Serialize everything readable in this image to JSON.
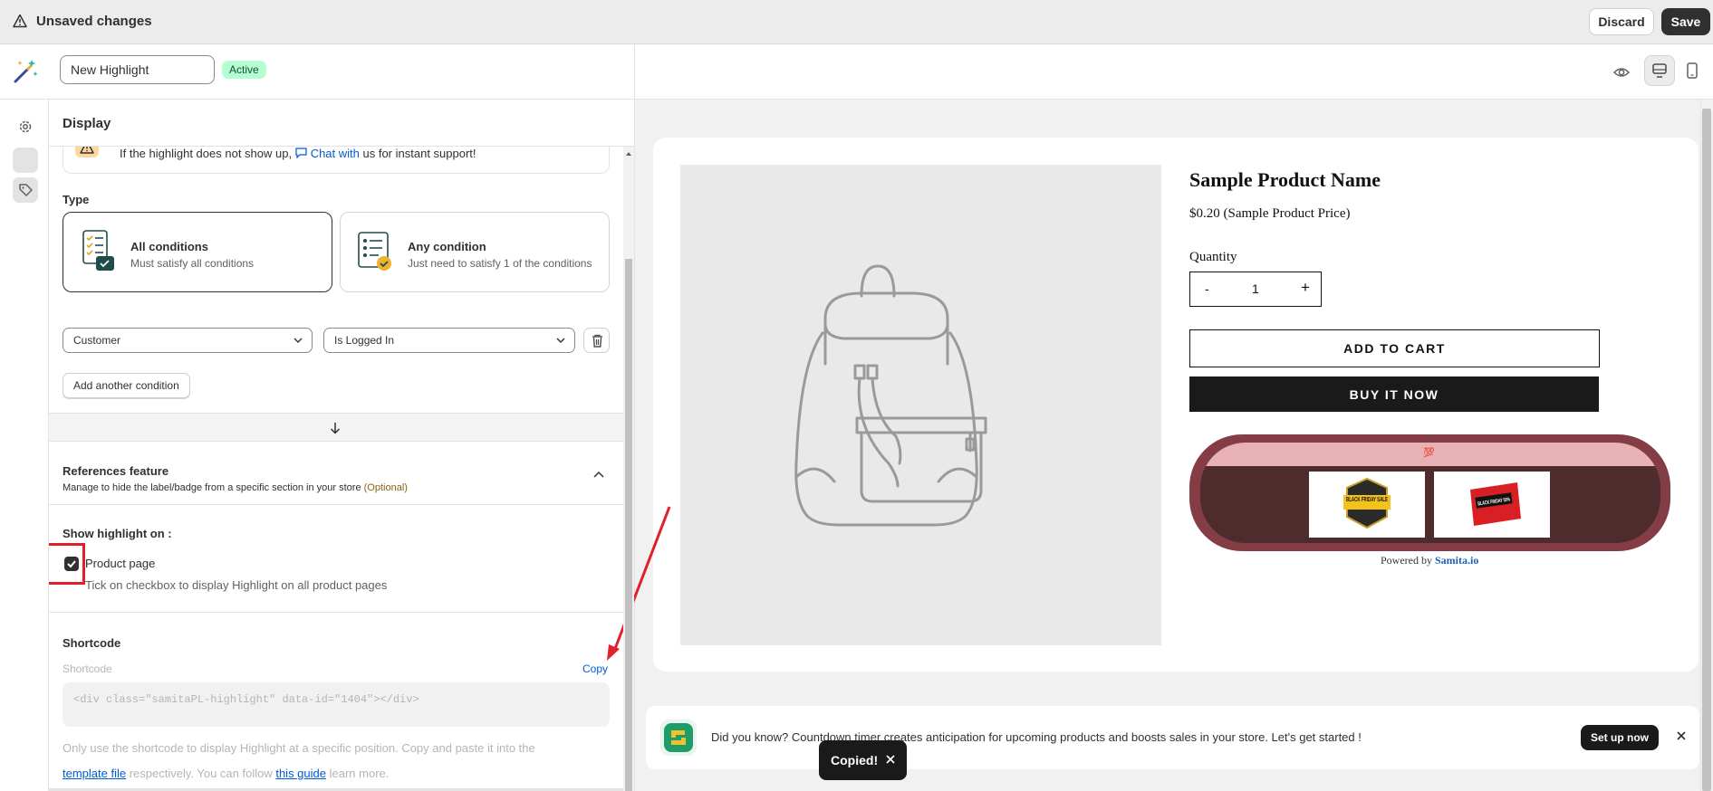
{
  "topbar": {
    "title": "Unsaved changes",
    "discard_label": "Discard",
    "save_label": "Save"
  },
  "subbar": {
    "highlight_name": "New Highlight",
    "status_badge": "Active"
  },
  "panel": {
    "header": "Display",
    "notice": {
      "before": "If the highlight does not show up, ",
      "link": "Chat with",
      "after": " us for instant support!"
    },
    "type_label": "Type",
    "conditions": [
      {
        "title": "All conditions",
        "subtitle": "Must satisfy all conditions",
        "selected": true
      },
      {
        "title": "Any condition",
        "subtitle": "Just need to satisfy 1 of the conditions",
        "selected": false
      }
    ],
    "condition_field": "Customer",
    "condition_value": "Is Logged In",
    "add_condition_label": "Add another condition",
    "references": {
      "title": "References feature",
      "description": "Manage to hide the label/badge from a specific section in your store ",
      "optional": "(Optional)"
    },
    "show_on": {
      "title": "Show highlight on :",
      "checkbox_label": "Product page",
      "checked": true,
      "help": "Tick on checkbox to display Highlight on all product pages"
    },
    "shortcode": {
      "title": "Shortcode",
      "field_label": "Shortcode",
      "copy_label": "Copy",
      "value": "<div class=\"samitaPL-highlight\" data-id=\"1404\"></div>",
      "help1": "Only use the shortcode to display Highlight at a specific position. Copy and paste it into the",
      "template_link": "template file",
      "help2_mid": " respectively. You can follow ",
      "guide_link": "this guide",
      "help2_end": " learn more."
    }
  },
  "preview": {
    "product_name": "Sample Product Name",
    "price": "$0.20 (Sample Product Price)",
    "quantity_label": "Quantity",
    "qty_minus": "-",
    "qty_value": "1",
    "qty_plus": "+",
    "add_to_cart": "ADD TO CART",
    "buy_it_now": "BUY IT NOW",
    "highlight_top_text": "💯",
    "powered_by": "Powered by ",
    "powered_brand": "Samita.io",
    "badges": [
      "BLACK FRIDAY SALE",
      "BLACK FRIDAY 50%"
    ]
  },
  "banner": {
    "message": "Did you know? Countdown timer creates anticipation for upcoming products and boosts sales in your store. Let's get started !",
    "cta": "Set up now"
  },
  "toast": {
    "message": "Copied!"
  }
}
